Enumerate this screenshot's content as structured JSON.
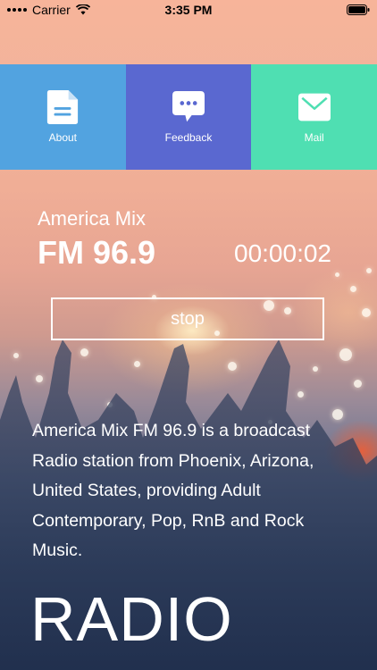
{
  "status_bar": {
    "carrier": "Carrier",
    "time": "3:35 PM"
  },
  "menu": {
    "items": [
      {
        "label": "About",
        "icon": "document-icon",
        "color": "#52a3e0"
      },
      {
        "label": "Feedback",
        "icon": "chat-bubble-icon",
        "color": "#5a68d0"
      },
      {
        "label": "Mail",
        "icon": "mail-icon",
        "color": "#4fdfb2"
      }
    ]
  },
  "player": {
    "station_name": "America Mix",
    "frequency": "FM 96.9",
    "elapsed": "00:00:02",
    "stop_label": "stop"
  },
  "description": "America Mix FM 96.9 is a broadcast Radio station from Phoenix, Arizona, United States, providing Adult Contemporary, Pop, RnB and Rock Music.",
  "footer_title": "RADIO"
}
